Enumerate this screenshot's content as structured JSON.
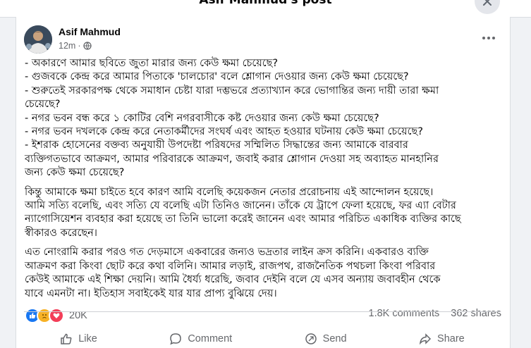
{
  "dialog": {
    "title": "Asif Mahmud's post",
    "close_icon": "close-icon"
  },
  "post": {
    "author": "Asif Mahmud",
    "time": "12m",
    "visibility_icon": "globe-icon",
    "paragraphs": [
      [
        "- অকারণে আমার ছবিতে জুতা মারার জন্য কেউ ক্ষমা চেয়েছে?",
        "- গুজবকে কেন্দ্র করে আমার পিতাকে 'চালচোর' বলে শ্লোগান দেওয়ার জন্য কেউ ক্ষমা চেয়েছে?",
        "- শুরুতেই সরকারপক্ষ থেকে সমাধান চেষ্টা যারা দম্ভভরে প্রত্যাখ্যান করে ভোগান্তির জন্য দায়ী তারা ক্ষমা",
        "চেয়েছে?",
        "- নগর ভবন বন্ধ করে ১ কোটির বেশি নগরবাসীকে কষ্ট দেওয়ার জন্য কেউ ক্ষমা চেয়েছে?",
        "- নগর ভবন দখলকে কেন্দ্র করে নেতাকর্মীদের সংঘর্ষ এবং আহত হওয়ার ঘটনায় কেউ ক্ষমা চেয়েছে?",
        "- ইশরাক হোসেনের বক্তব্য অনুযায়ী উপদেষ্টা পরিষদের সম্মিলিত সিদ্ধান্তের জন্য আমাকে বারবার",
        "ব্যক্তিগতভাবে আক্রমণ, আমার পরিবারকে আক্রমণ, জবাই করার শ্লোগান দেওয়া সহ অব্যাহত মানহানির",
        "জন্য কেউ ক্ষমা চেয়েছে?"
      ],
      [
        "কিন্তু আমাকে ক্ষমা চাইতে হবে কারণ আমি বলেছি কয়েকজন নেতার প্ররোচনায় এই আন্দোলন হয়েছে।",
        "আমি সত্যি বলেছি, এবং সত্যি যে বলেছি এটা তিনিও জানেন। তাঁকে যে ট্রাপে ফেলা হয়েছে, ফর এ্যা বেটার",
        "ন্যাগোসিয়েশন ব্যবহার করা হয়েছে তা তিনি ভালো করেই জানেন এবং আমার পরিচিত একাধিক ব্যক্তির কাছে",
        "স্বীকারও করেছেন।"
      ],
      [
        "এত নোংরামি করার পরও গত দেড়মাসে একবারের জন্যও ভদ্রতার লাইন ক্রস করিনি। একবারও ব্যক্তি",
        "আক্রমণ করা কিংবা ছোট করে কথা বলিনি। আমার লড়াই, রাজপথ, রাজনৈতিক পথচলা কিংবা পরিবার",
        "কেউই আমাকে এই শিক্ষা দেয়নি। আমি ধৈর্য্য ধরেছি, জবাব দেইনি বলে যে এসব অন্যায় জবাবহীন থেকে",
        "যাবে এমনটা না। ইতিহাস সবাইকেই যার যার প্রাপ্য বুঝিয়ে দেয়।"
      ]
    ]
  },
  "stats": {
    "reactions": [
      "like",
      "sad",
      "love"
    ],
    "reaction_count": "20K",
    "comments": "1.8K comments",
    "shares": "362 shares"
  },
  "actions": [
    {
      "label": "Like",
      "icon": "like-icon"
    },
    {
      "label": "Comment",
      "icon": "comment-icon"
    },
    {
      "label": "Send",
      "icon": "send-icon"
    },
    {
      "label": "Share",
      "icon": "share-icon"
    }
  ],
  "colors": {
    "like": "#1877f2",
    "sad": "#f7b125",
    "love": "#f33e58",
    "secondary_text": "#65676b"
  }
}
